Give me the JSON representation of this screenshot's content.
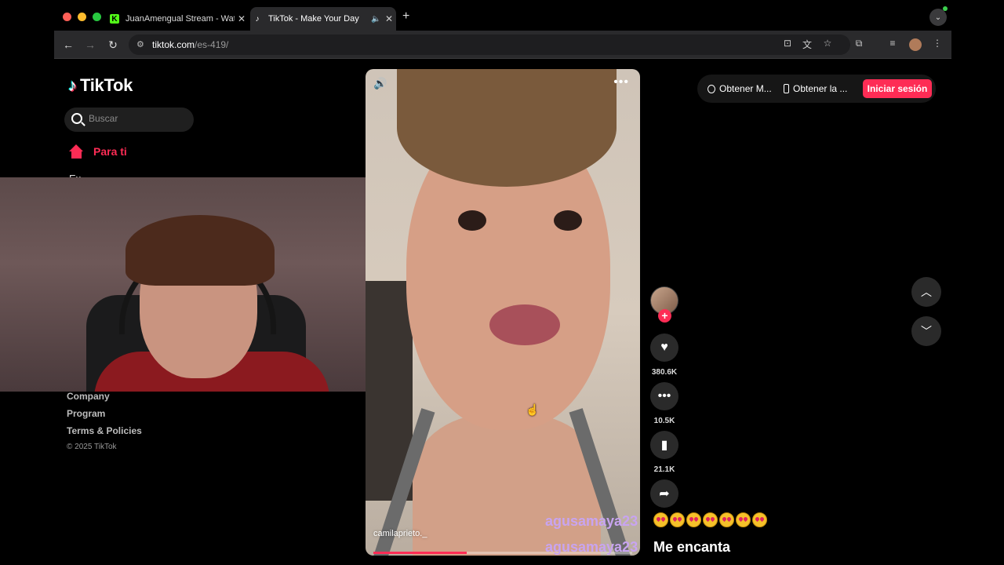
{
  "browser": {
    "tabs": [
      {
        "title": "JuanAmengual Stream - Watc",
        "favicon": "K"
      },
      {
        "title": "TikTok - Make Your Day",
        "favicon": "♪"
      }
    ],
    "url_host": "tiktok.com",
    "url_path": "/es-419/"
  },
  "sidebar": {
    "brand": "TikTok",
    "search_placeholder": "Buscar",
    "nav_foryou": "Para ti",
    "nav_second_partial": "Ex",
    "footer": [
      "Company",
      "Program",
      "Terms & Policies"
    ],
    "copyright": "© 2025 TikTok"
  },
  "header": {
    "btn_app_pc": "Obtener M...",
    "btn_app_mobile": "Obtener la ...",
    "login": "Iniciar sesión"
  },
  "video": {
    "author": "camilaprieto._",
    "progress_fraction": 0.36
  },
  "actions": {
    "likes": "380.6K",
    "comments": "10.5K",
    "saves": "21.1K"
  },
  "chat": [
    {
      "user": "agusamaya23",
      "message": "",
      "emoji_count": 7
    },
    {
      "user": "agusamaya23",
      "message": "Me encanta"
    }
  ],
  "colors": {
    "accent": "#fe2c55",
    "chat_user": "#c8a4f0"
  }
}
